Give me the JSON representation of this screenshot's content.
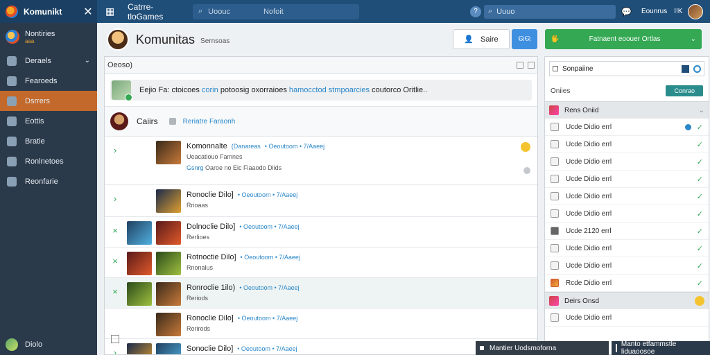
{
  "topbar": {
    "brand": "Komunikt",
    "close_glyph": "✕",
    "grid_glyph": "▦",
    "title": "Catrre-tloGames",
    "search_left_text": "Uoouc",
    "search_left_text2": "Nofoit",
    "help_glyph": "?",
    "search_right_text": "Uuuo",
    "chat_glyph": "💬",
    "user_label": "Eounrus",
    "bell_label": "I!K"
  },
  "sidebar": {
    "profile_name": "Nontiries",
    "profile_sub": "aaa",
    "items": [
      {
        "label": "Deraels",
        "icon": "folder-icon",
        "has_chevron": true,
        "chevron": "⌄"
      },
      {
        "label": "Fearoeds",
        "icon": "person-icon"
      },
      {
        "label": "Dsrrers",
        "icon": "game-icon",
        "active": true
      },
      {
        "label": "Eottis",
        "icon": "document-icon"
      },
      {
        "label": "Bratie",
        "icon": "chat-icon"
      },
      {
        "label": "Ronlnetoes",
        "icon": "grid-icon"
      },
      {
        "label": "Reonfarie",
        "icon": "camera-icon"
      }
    ],
    "footer_label": "Diolo"
  },
  "header": {
    "title": "Komunitas",
    "subtitle": "Sernsoas",
    "save_button": "Saire",
    "save_icon": "👤",
    "blue_button": "ଉଉ",
    "green_button": "Fatnaent eoouer Ortlas",
    "green_icon": "🖐",
    "green_chevron": "⌄"
  },
  "feed": {
    "header_label": "Oeoso)",
    "compose_lead": "Eejio Fa:",
    "compose_mid": "ctoicoes",
    "compose_blue1": "corin",
    "compose_text": "potoosig oxorraioes",
    "compose_blue2": "hamocctod stmpoarcies",
    "compose_tail": "coutorco Oritlie..",
    "group_name": "Caiirs",
    "group_link": "Reriatre Faraonh",
    "posts": [
      {
        "title": "Komonnalte",
        "paren": "(Danareas",
        "meta": "• Oeoutoom • 7/Aaeej",
        "line2": "Ueacatiouo Famnes",
        "line3a": "Gsnrg",
        "line3b": "Oaroe no Eic Fiaaodo Diids",
        "mark": "›",
        "alt": false,
        "emoji": "😊"
      },
      {
        "title": "Ronoclie Dilo]",
        "paren": "",
        "meta": "• Oeoutoom • 7/Aaeej",
        "line2": "Rrioaas",
        "line3a": "",
        "line3b": "",
        "mark": "›",
        "alt": false
      },
      {
        "title": "Dolnoclie Dilo]",
        "paren": "",
        "meta": "• Oeoutoom • 7/Aaeej",
        "line2": "Rerlioes",
        "line3a": "",
        "line3b": "",
        "mark": "×",
        "alt": false
      },
      {
        "title": "Rotnoctie Dilo]",
        "paren": "",
        "meta": "• Oeoutoom • 7/Aaeej",
        "line2": "Rnonalus",
        "line3a": "",
        "line3b": "",
        "mark": "×",
        "alt": false
      },
      {
        "title": "Ronroclie 1ilo)",
        "paren": "",
        "meta": "• Oeoutoom • 7/Aaeej",
        "line2": "Reriods",
        "line3a": "",
        "line3b": "",
        "mark": "×",
        "alt": true
      },
      {
        "title": "Ronoclie Dilo]",
        "paren": "",
        "meta": "• Oeoutoom • 7/Aaeej",
        "line2": "Rorirods",
        "line3a": "",
        "line3b": "",
        "mark": "box",
        "alt": false
      },
      {
        "title": "Sonoclie Dilo]",
        "paren": "",
        "meta": "• Oeoutoom • 7/Aaeej",
        "line2": "",
        "line3a": "",
        "line3b": "",
        "mark": "›",
        "alt": false
      }
    ]
  },
  "right": {
    "search_text": "Sonpaiine",
    "online_label": "Oniies",
    "online_button": "Conrao",
    "section1": "Rens Oniid",
    "section2": "Deirs Onsd",
    "rows": [
      {
        "label": "Ucde Didio errl",
        "badge": true
      },
      {
        "label": "Ucde Didio errl"
      },
      {
        "label": "Ucde Didio errl"
      },
      {
        "label": "Ucde Didio errl"
      },
      {
        "label": "Ucde Didio errl"
      },
      {
        "label": "Ucde Didio errl"
      },
      {
        "label": "Ucde 2120 errl",
        "dark": true
      },
      {
        "label": "Ucde Didio errl"
      },
      {
        "label": "Ucde Didio errl"
      },
      {
        "label": "Rcde Didio errl",
        "colored": true
      }
    ],
    "row_after_section2": "Ucde Didio errl"
  },
  "popups": {
    "left": "Mantier Uodsmoforna",
    "right": "Manto etfammstle liduaoosoe"
  },
  "colors": {
    "topbar": "#1f4e79",
    "sidebar": "#2b3a4a",
    "active": "#c2692b",
    "green": "#34a853",
    "blue": "#3f8fe0",
    "link": "#2a87c8"
  }
}
